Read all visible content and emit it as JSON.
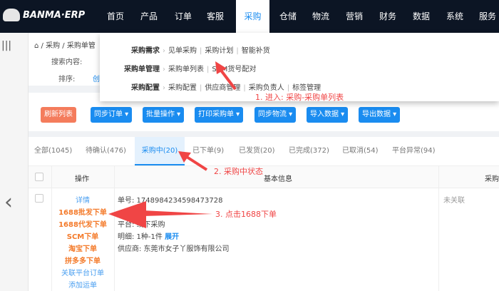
{
  "header": {
    "logo": "BANMA·ERP",
    "nav": [
      "首页",
      "产品",
      "订单",
      "客服",
      "采购",
      "仓储",
      "物流",
      "营销",
      "财务",
      "数据",
      "系统",
      "服务"
    ],
    "active": "采购"
  },
  "breadcrumb": "/ 采购 / 采购单管",
  "search": {
    "content_label": "搜索内容:",
    "sort_label": "排序:",
    "sort_value": "创"
  },
  "dropdown": {
    "rows": [
      {
        "title": "采购需求",
        "items": [
          "见单采购",
          "采购计划",
          "智能补货"
        ]
      },
      {
        "title": "采购单管理",
        "items": [
          "采购单列表",
          "SCM货号配对"
        ]
      },
      {
        "title": "采购配置",
        "items": [
          "采购配置",
          "供应商管理",
          "采购负责人",
          "标签管理"
        ]
      }
    ]
  },
  "toolbar": [
    "刷新列表",
    "同步订单 ▾",
    "批量操作 ▾",
    "打印采购单 ▾",
    "同步物流 ▾",
    "导入数据 ▾",
    "导出数据 ▾"
  ],
  "tabs": [
    "全部(1045)",
    "待确认(476)",
    "采购中(20)",
    "已下单(9)",
    "已发货(20)",
    "已完成(372)",
    "已取消(54)",
    "平台异常(94)"
  ],
  "table": {
    "headers": [
      "操作",
      "基本信息",
      "采购"
    ],
    "row": {
      "actions": [
        {
          "label": "详情",
          "color": "blue"
        },
        {
          "label": "1688批发下单",
          "color": "orange"
        },
        {
          "label": "1688代发下单",
          "color": "orange"
        },
        {
          "label": "SCM下单",
          "color": "orange"
        },
        {
          "label": "淘宝下单",
          "color": "orange"
        },
        {
          "label": "拼多多下单",
          "color": "orange"
        },
        {
          "label": "关联平台订单",
          "color": "blue"
        },
        {
          "label": "添加运单",
          "color": "blue"
        }
      ],
      "order_no": "单号: 1748984234598473728",
      "type": "平台: 线下采购",
      "detail_label": "明细: 1种-1件",
      "expand": "展开",
      "supplier": "供应商: 东莞市女子丫服饰有限公司",
      "status": "未关联"
    }
  },
  "annotations": [
    "1. 进入: 采购-采购单列表",
    "2. 采购中状态",
    "3. 点击1688下单"
  ]
}
